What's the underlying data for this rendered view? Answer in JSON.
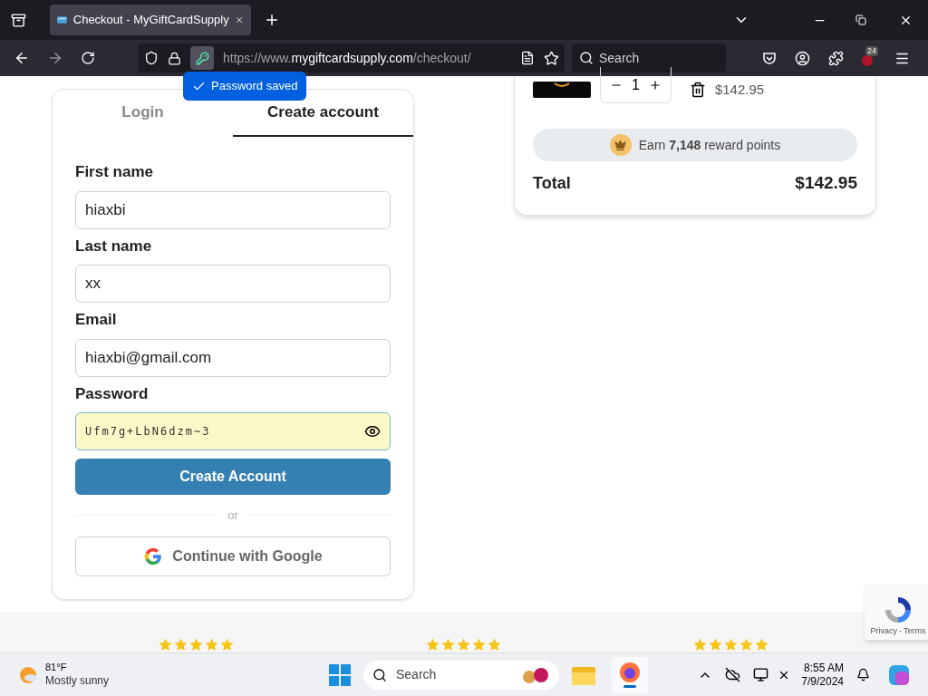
{
  "browser": {
    "tab_title": "Checkout - MyGiftCardSupply",
    "url": {
      "prefix": "https://www.",
      "domain": "mygiftcardsupply.com",
      "path": "/checkout/"
    },
    "search_placeholder": "Search",
    "extensions_badge": "24",
    "password_popup": "Password saved"
  },
  "auth": {
    "tabs": [
      {
        "label": "Login",
        "selected": false
      },
      {
        "label": "Create account",
        "selected": true
      }
    ],
    "fields": [
      {
        "label": "First name",
        "value": "hiaxbi",
        "kind": "text"
      },
      {
        "label": "Last name",
        "value": "xx",
        "kind": "text"
      },
      {
        "label": "Email",
        "value": "hiaxbi@gmail.com",
        "kind": "text"
      },
      {
        "label": "Password",
        "value": "Ufm7g+LbN6dzm~3",
        "kind": "password"
      }
    ],
    "submit": "Create Account",
    "divider": "or",
    "google": "Continue with Google"
  },
  "cart": {
    "quantity": "1",
    "price": "$142.95",
    "rewards": "Earn **7,148** reward points",
    "total_label": "Total",
    "total": "$142.95"
  },
  "reviews": [
    {
      "stars": 5
    },
    {
      "stars": 5
    },
    {
      "stars": 5
    }
  ],
  "recaptcha": {
    "links": [
      "Privacy",
      "Terms"
    ],
    "separator": "-"
  },
  "taskbar": {
    "temperature": "81°F",
    "condition": "Mostly sunny",
    "search_placeholder": "Search",
    "time": "8:55 AM",
    "date": "7/9/2024"
  }
}
